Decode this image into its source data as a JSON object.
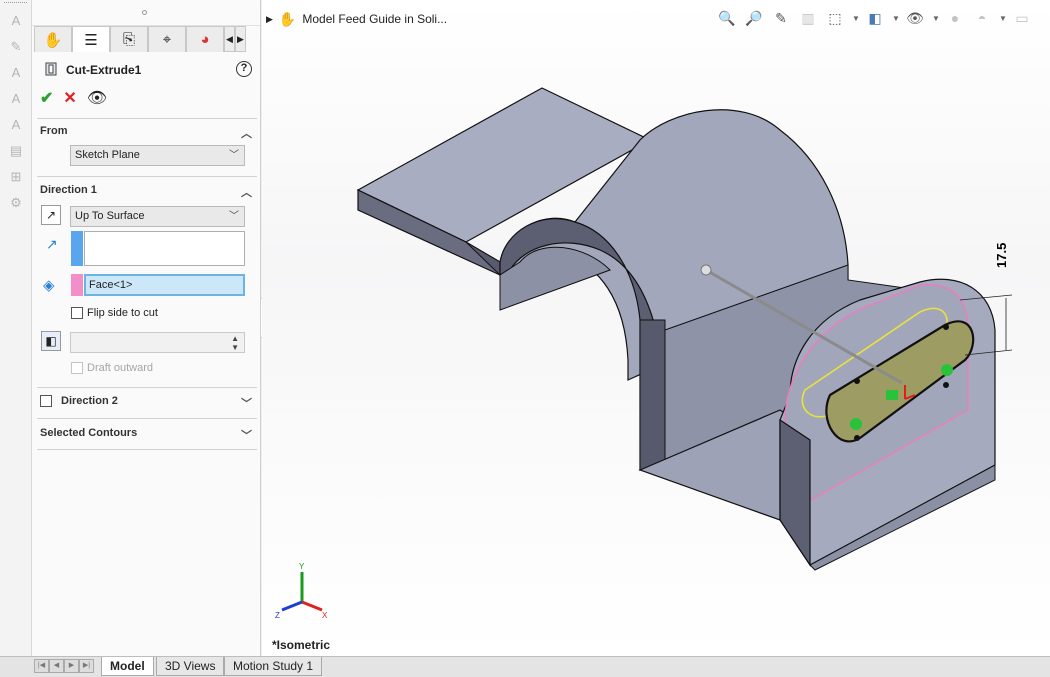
{
  "window": {
    "document_title": "Model Feed Guide in Soli..."
  },
  "property_manager": {
    "title": "Cut-Extrude1",
    "help": "?",
    "tabs": [
      "featuremanager-tab",
      "propertymanager-tab",
      "configurationmanager-tab",
      "dimxpert-tab",
      "display-tab"
    ],
    "from": {
      "header": "From",
      "value": "Sketch Plane"
    },
    "direction1": {
      "header": "Direction 1",
      "end_condition": "Up To Surface",
      "face_value": "Face<1>",
      "flip_label": "Flip side to cut",
      "draft_outward_label": "Draft outward",
      "depth_value": "",
      "swatch_blue": "#5aa6ee",
      "swatch_pink": "#f28ec8"
    },
    "direction2": {
      "header": "Direction 2"
    },
    "selected_contours": {
      "header": "Selected Contours"
    }
  },
  "viewport": {
    "dimension_label": "17.5",
    "view_name": "*Isometric",
    "triad": {
      "x": "X",
      "y": "Y",
      "z": "Z"
    }
  },
  "bottom_tabs": [
    {
      "label": "Model",
      "active": true
    },
    {
      "label": "3D Views",
      "active": false
    },
    {
      "label": "Motion Study 1",
      "active": false
    }
  ],
  "colors": {
    "part_face": "#a3a7bc",
    "part_dark": "#5f6275",
    "selection_pink": "#f279c1",
    "preview_yellow": "#e8e23a"
  }
}
